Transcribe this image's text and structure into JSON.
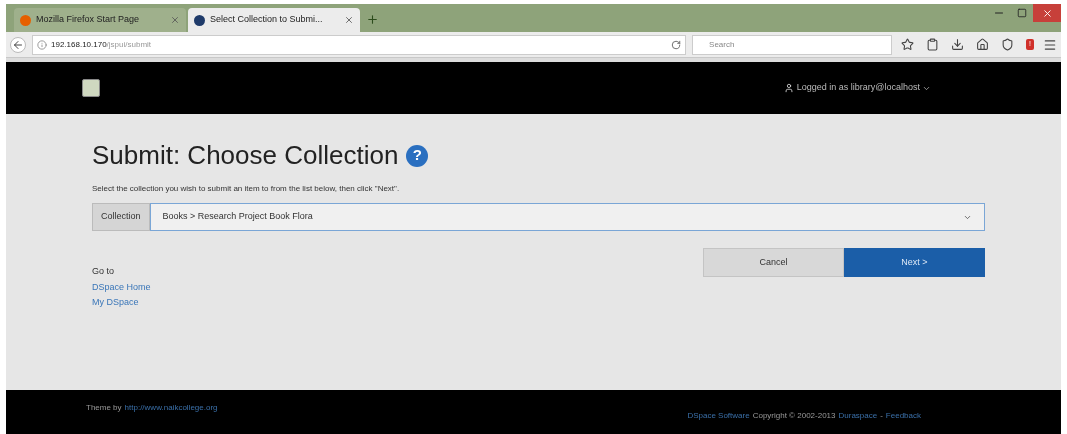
{
  "browser": {
    "tabs": [
      {
        "title": "Mozilla Firefox Start Page",
        "selected": false
      },
      {
        "title": "Select Collection to Submi...",
        "selected": true
      }
    ],
    "url": {
      "host": "192.168.10.170",
      "path": "/jspui/submit"
    },
    "search": {
      "placeholder": "Search"
    },
    "badge": "!"
  },
  "header": {
    "user": "Logged in as library@localhost"
  },
  "page": {
    "title": "Submit: Choose Collection",
    "help": "?",
    "instruction": "Select the collection you wish to submit an item to from the list below, then click \"Next\".",
    "collection": {
      "label": "Collection",
      "value": "Books > Research Project Book Flora"
    },
    "buttons": [
      {
        "label": "Cancel",
        "kind": "default"
      },
      {
        "label": "Next >",
        "kind": "primary"
      }
    ],
    "goto": {
      "heading": "Go to",
      "links": [
        "DSpace Home",
        "My DSpace"
      ]
    }
  },
  "footer": {
    "theme_by": "Theme by",
    "theme_link": "http://www.naikcollege.org",
    "right": [
      {
        "text": "DSpace Software",
        "kind": "link"
      },
      {
        "text": "Copyright © 2002-2013",
        "kind": "text"
      },
      {
        "text": "Duraspace",
        "kind": "link"
      },
      {
        "text": "-",
        "kind": "text"
      },
      {
        "text": "Feedback",
        "kind": "link"
      }
    ]
  }
}
